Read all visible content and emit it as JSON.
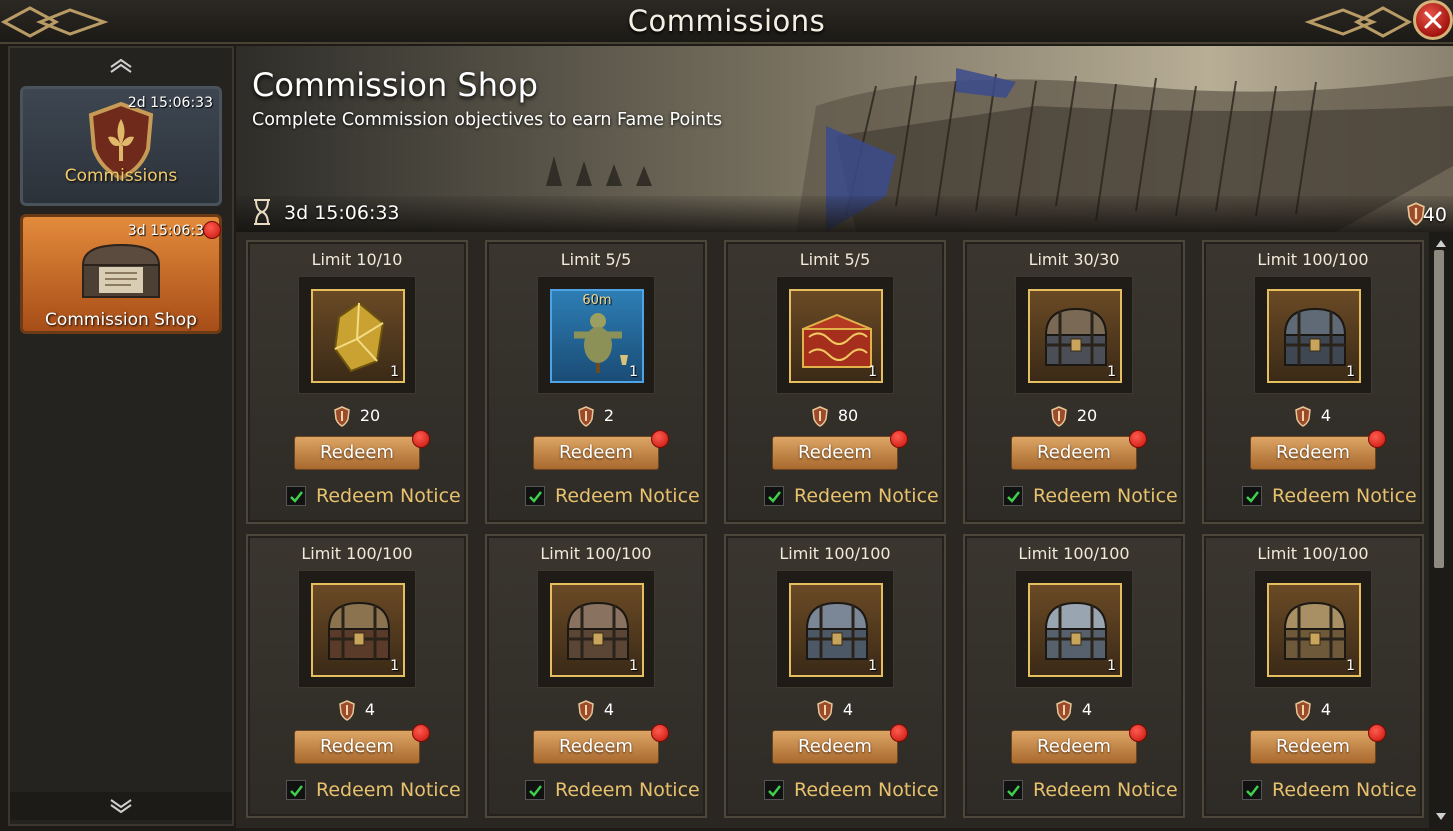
{
  "window": {
    "title": "Commissions"
  },
  "sidebar": {
    "items": [
      {
        "label": "Commissions",
        "timer": "2d 15:06:33",
        "icon": "shield-fleur-icon"
      },
      {
        "label": "Commission Shop",
        "timer": "3d 15:06:33",
        "icon": "chest-icon"
      }
    ]
  },
  "banner": {
    "title": "Commission Shop",
    "subtitle": "Complete Commission objectives to earn Fame Points",
    "timer": "3d 15:06:33",
    "fame_points": "40"
  },
  "shop": {
    "redeem_label": "Redeem",
    "notice_label": "Redeem Notice",
    "items": [
      {
        "limit": "Limit 10/10",
        "price": "20",
        "qty": "1",
        "icon": "gold-crystal-icon"
      },
      {
        "limit": "Limit 5/5",
        "price": "2",
        "qty": "1",
        "icon": "training-dummy-icon",
        "tag": "60m"
      },
      {
        "limit": "Limit 5/5",
        "price": "80",
        "qty": "1",
        "icon": "ornate-red-chest-icon"
      },
      {
        "limit": "Limit 30/30",
        "price": "20",
        "qty": "1",
        "icon": "iron-chest-icon"
      },
      {
        "limit": "Limit 100/100",
        "price": "4",
        "qty": "1",
        "icon": "dark-iron-chest-icon"
      },
      {
        "limit": "Limit 100/100",
        "price": "4",
        "qty": "1",
        "icon": "wooden-chest-icon"
      },
      {
        "limit": "Limit 100/100",
        "price": "4",
        "qty": "1",
        "icon": "bronze-chest-icon"
      },
      {
        "limit": "Limit 100/100",
        "price": "4",
        "qty": "1",
        "icon": "steel-chest-icon"
      },
      {
        "limit": "Limit 100/100",
        "price": "4",
        "qty": "1",
        "icon": "silver-chest-icon"
      },
      {
        "limit": "Limit 100/100",
        "price": "4",
        "qty": "1",
        "icon": "brass-chest-icon"
      }
    ]
  },
  "colors": {
    "accent_gold": "#e7c16d",
    "button": "#c48a4a",
    "badge_red": "#d21c12",
    "active_tab": "#d77a32"
  }
}
